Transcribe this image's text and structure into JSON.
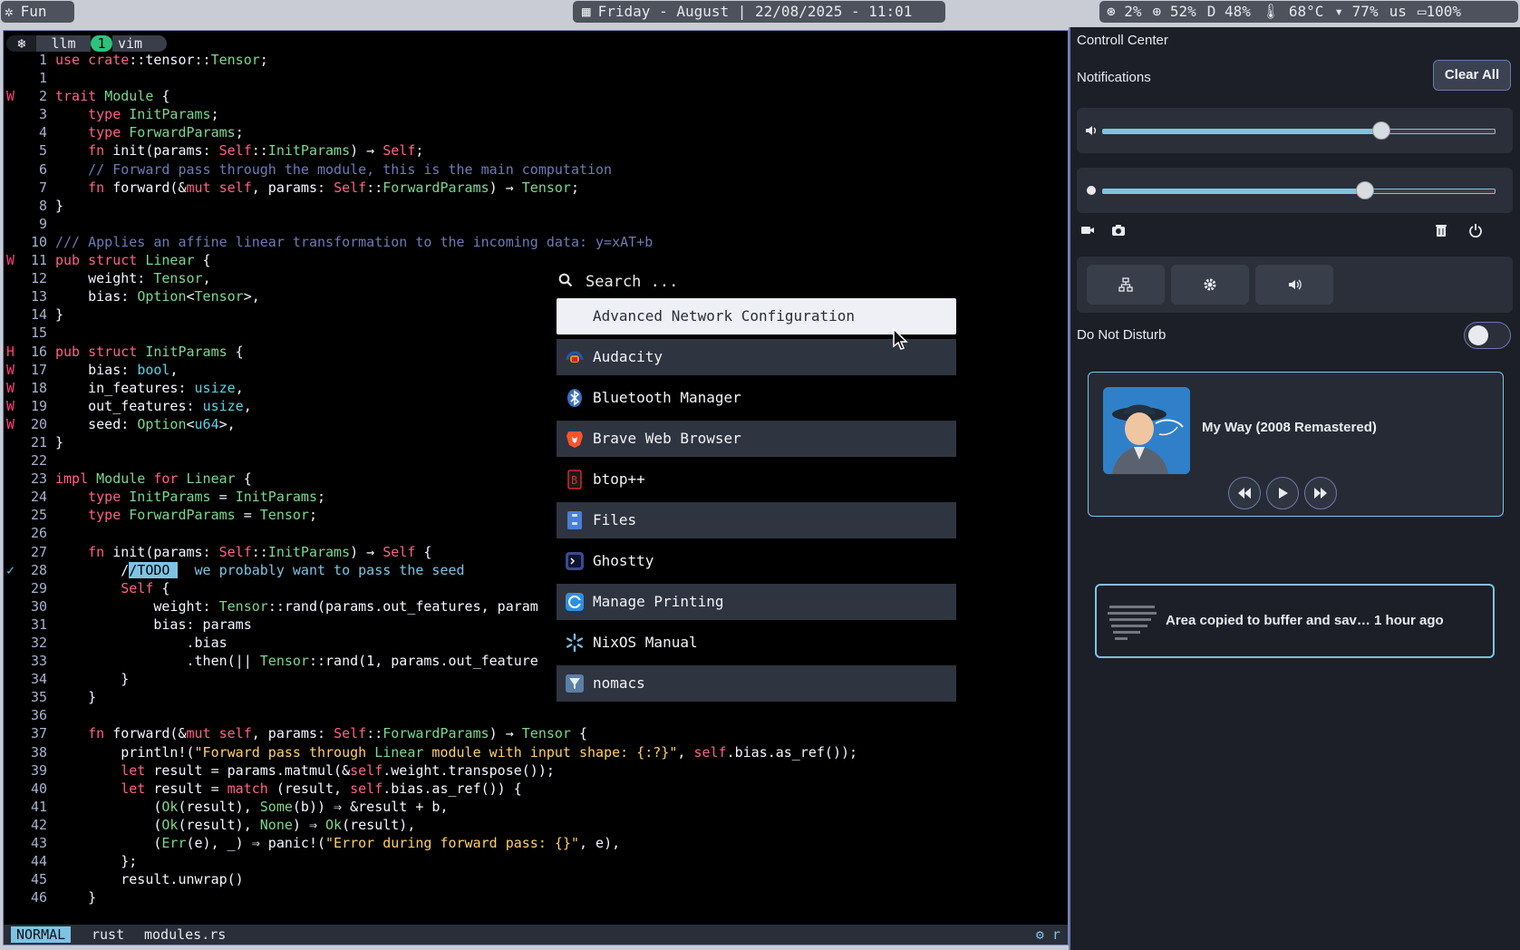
{
  "topbar": {
    "workspace": "Fun",
    "datetime": "Friday - August | 22/08/2025 - 11:01",
    "cpu": "2%",
    "ram": "52%",
    "disk": "D 48%",
    "temp": "68°C",
    "wifi": "77%",
    "layout": "us",
    "battery": "100%"
  },
  "editor": {
    "tabs": {
      "label_1": "llm",
      "num": "1",
      "label_2": "vim"
    },
    "lines": [
      {
        "n": "1",
        "s": "",
        "t": "use crate::tensor::Tensor;"
      },
      {
        "n": "1",
        "s": "",
        "t": ""
      },
      {
        "n": "2",
        "s": "W",
        "t": "trait Module {"
      },
      {
        "n": "3",
        "s": "",
        "t": "    type InitParams;"
      },
      {
        "n": "4",
        "s": "",
        "t": "    type ForwardParams;"
      },
      {
        "n": "5",
        "s": "",
        "t": "    fn init(params: Self::InitParams) → Self;"
      },
      {
        "n": "6",
        "s": "",
        "t": "    // Forward pass through the module, this is the main computation"
      },
      {
        "n": "7",
        "s": "",
        "t": "    fn forward(&mut self, params: Self::ForwardParams) → Tensor;"
      },
      {
        "n": "8",
        "s": "",
        "t": "}"
      },
      {
        "n": "9",
        "s": "",
        "t": ""
      },
      {
        "n": "10",
        "s": "",
        "t": "/// Applies an affine linear transformation to the incoming data: y=xAT+b"
      },
      {
        "n": "11",
        "s": "W",
        "t": "pub struct Linear {"
      },
      {
        "n": "12",
        "s": "",
        "t": "    weight: Tensor,"
      },
      {
        "n": "13",
        "s": "",
        "t": "    bias: Option<Tensor>,"
      },
      {
        "n": "14",
        "s": "",
        "t": "}"
      },
      {
        "n": "15",
        "s": "",
        "t": ""
      },
      {
        "n": "16",
        "s": "H",
        "t": "pub struct InitParams {"
      },
      {
        "n": "17",
        "s": "W",
        "t": "    bias: bool,"
      },
      {
        "n": "18",
        "s": "W",
        "t": "    in_features: usize,"
      },
      {
        "n": "19",
        "s": "W",
        "t": "    out_features: usize,"
      },
      {
        "n": "20",
        "s": "W",
        "t": "    seed: Option<u64>,"
      },
      {
        "n": "21",
        "s": "",
        "t": "}"
      },
      {
        "n": "22",
        "s": "",
        "t": ""
      },
      {
        "n": "23",
        "s": "",
        "t": "impl Module for Linear {"
      },
      {
        "n": "24",
        "s": "",
        "t": "    type InitParams = InitParams;"
      },
      {
        "n": "25",
        "s": "",
        "t": "    type ForwardParams = Tensor;"
      },
      {
        "n": "26",
        "s": "",
        "t": ""
      },
      {
        "n": "27",
        "s": "",
        "t": "    fn init(params: Self::InitParams) → Self {"
      },
      {
        "n": "28",
        "s": "✓",
        "t": "        //TODO  we probably want to pass the seed"
      },
      {
        "n": "29",
        "s": "",
        "t": "        Self {"
      },
      {
        "n": "30",
        "s": "",
        "t": "            weight: Tensor::rand(params.out_features, param"
      },
      {
        "n": "31",
        "s": "",
        "t": "            bias: params"
      },
      {
        "n": "32",
        "s": "",
        "t": "                .bias"
      },
      {
        "n": "33",
        "s": "",
        "t": "                .then(|| Tensor::rand(1, params.out_feature"
      },
      {
        "n": "34",
        "s": "",
        "t": "        }"
      },
      {
        "n": "35",
        "s": "",
        "t": "    }"
      },
      {
        "n": "36",
        "s": "",
        "t": ""
      },
      {
        "n": "37",
        "s": "",
        "t": "    fn forward(&mut self, params: Self::ForwardParams) → Tensor {"
      },
      {
        "n": "38",
        "s": "",
        "t": "        println!(\"Forward pass through Linear module with input shape: {:?}\", self.bias.as_ref());"
      },
      {
        "n": "39",
        "s": "",
        "t": "        let result = params.matmul(&self.weight.transpose());"
      },
      {
        "n": "40",
        "s": "",
        "t": "        let result = match (result, self.bias.as_ref()) {"
      },
      {
        "n": "41",
        "s": "",
        "t": "            (Ok(result), Some(b)) ⇒ &result + b,"
      },
      {
        "n": "42",
        "s": "",
        "t": "            (Ok(result), None) ⇒ Ok(result),"
      },
      {
        "n": "43",
        "s": "",
        "t": "            (Err(e), _) ⇒ panic!(\"Error during forward pass: {}\", e),"
      },
      {
        "n": "44",
        "s": "",
        "t": "        };"
      },
      {
        "n": "45",
        "s": "",
        "t": "        result.unwrap()"
      },
      {
        "n": "46",
        "s": "",
        "t": "    }"
      }
    ],
    "status": {
      "mode": "NORMAL",
      "filetype": "rust",
      "filename": "modules.rs",
      "right": "r"
    }
  },
  "launcher": {
    "placeholder": "Search ...",
    "apps": [
      {
        "label": "Advanced Network Configuration",
        "icon": "network-config-icon"
      },
      {
        "label": "Audacity",
        "icon": "audacity-icon"
      },
      {
        "label": "Bluetooth Manager",
        "icon": "bluetooth-icon"
      },
      {
        "label": "Brave Web Browser",
        "icon": "brave-icon"
      },
      {
        "label": "btop++",
        "icon": "btop-icon"
      },
      {
        "label": "Files",
        "icon": "files-icon"
      },
      {
        "label": "Ghostty",
        "icon": "ghostty-icon"
      },
      {
        "label": "Manage Printing",
        "icon": "printing-icon"
      },
      {
        "label": "NixOS Manual",
        "icon": "nixos-icon"
      },
      {
        "label": "nomacs",
        "icon": "nomacs-icon"
      }
    ]
  },
  "control_center": {
    "title": "Controll Center",
    "notifications_label": "Notifications",
    "clear_all": "Clear All",
    "volume_level": 0.71,
    "brightness_level": 0.67,
    "dnd_label": "Do Not Disturb",
    "dnd_on": false,
    "media": {
      "title": "My Way (2008 Remastered)"
    },
    "toast": {
      "text": "Area copied to buffer and sav…  1 hour ago"
    }
  }
}
